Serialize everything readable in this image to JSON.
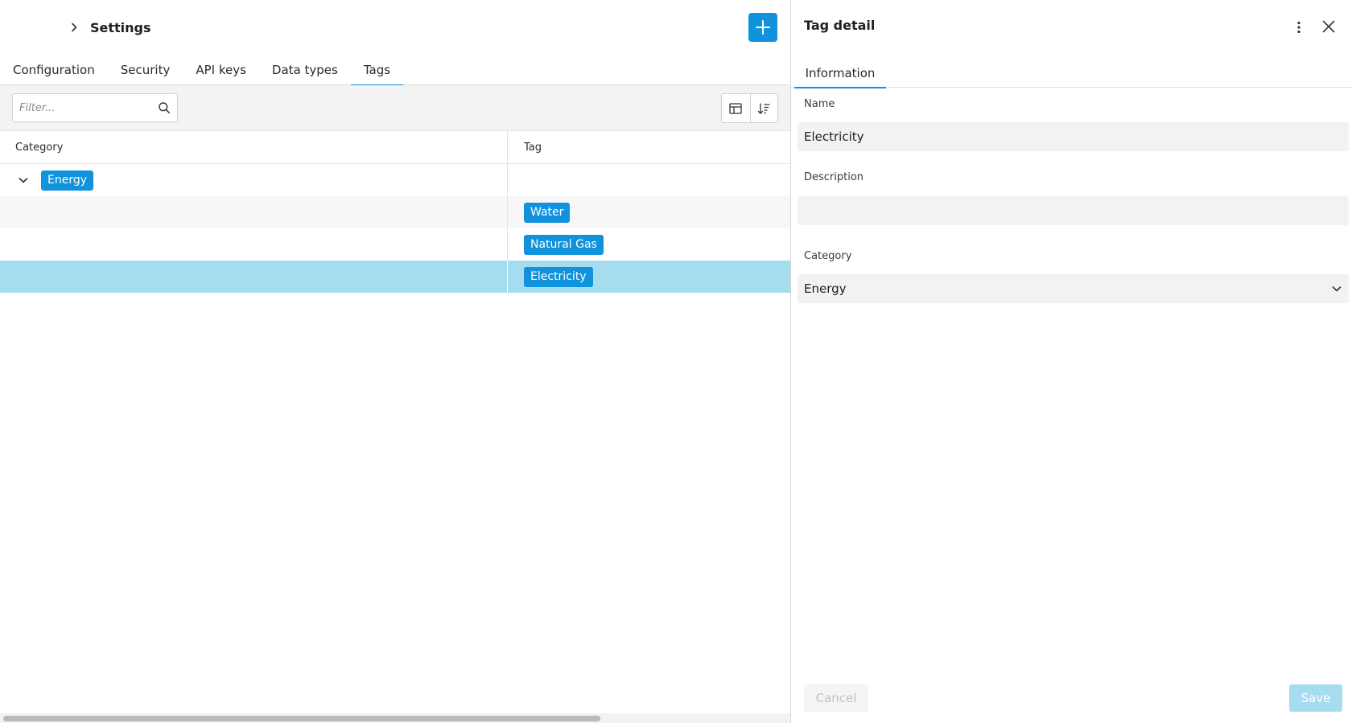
{
  "header": {
    "title": "Settings",
    "add_icon": "plus-icon"
  },
  "tabs": [
    {
      "label": "Configuration",
      "active": false
    },
    {
      "label": "Security",
      "active": false
    },
    {
      "label": "API keys",
      "active": false
    },
    {
      "label": "Data types",
      "active": false
    },
    {
      "label": "Tags",
      "active": true
    }
  ],
  "toolbar": {
    "filter_placeholder": "Filter...",
    "filter_value": ""
  },
  "table": {
    "columns": [
      "Category",
      "Tag"
    ],
    "group": {
      "label": "Energy",
      "expanded": true
    },
    "rows": [
      {
        "category": "",
        "tag": "Water",
        "selected": false
      },
      {
        "category": "",
        "tag": "Natural Gas",
        "selected": false
      },
      {
        "category": "",
        "tag": "Electricity",
        "selected": true
      }
    ]
  },
  "detail": {
    "title": "Tag detail",
    "tabs": [
      {
        "label": "Information",
        "active": true
      }
    ],
    "fields": {
      "name_label": "Name",
      "name_value": "Electricity",
      "description_label": "Description",
      "description_value": "",
      "category_label": "Category",
      "category_value": "Energy"
    },
    "cancel_label": "Cancel",
    "save_label": "Save"
  },
  "colors": {
    "accent": "#1192dc",
    "selected_row": "#a6dcf0",
    "field_background": "#f2f2f2"
  }
}
